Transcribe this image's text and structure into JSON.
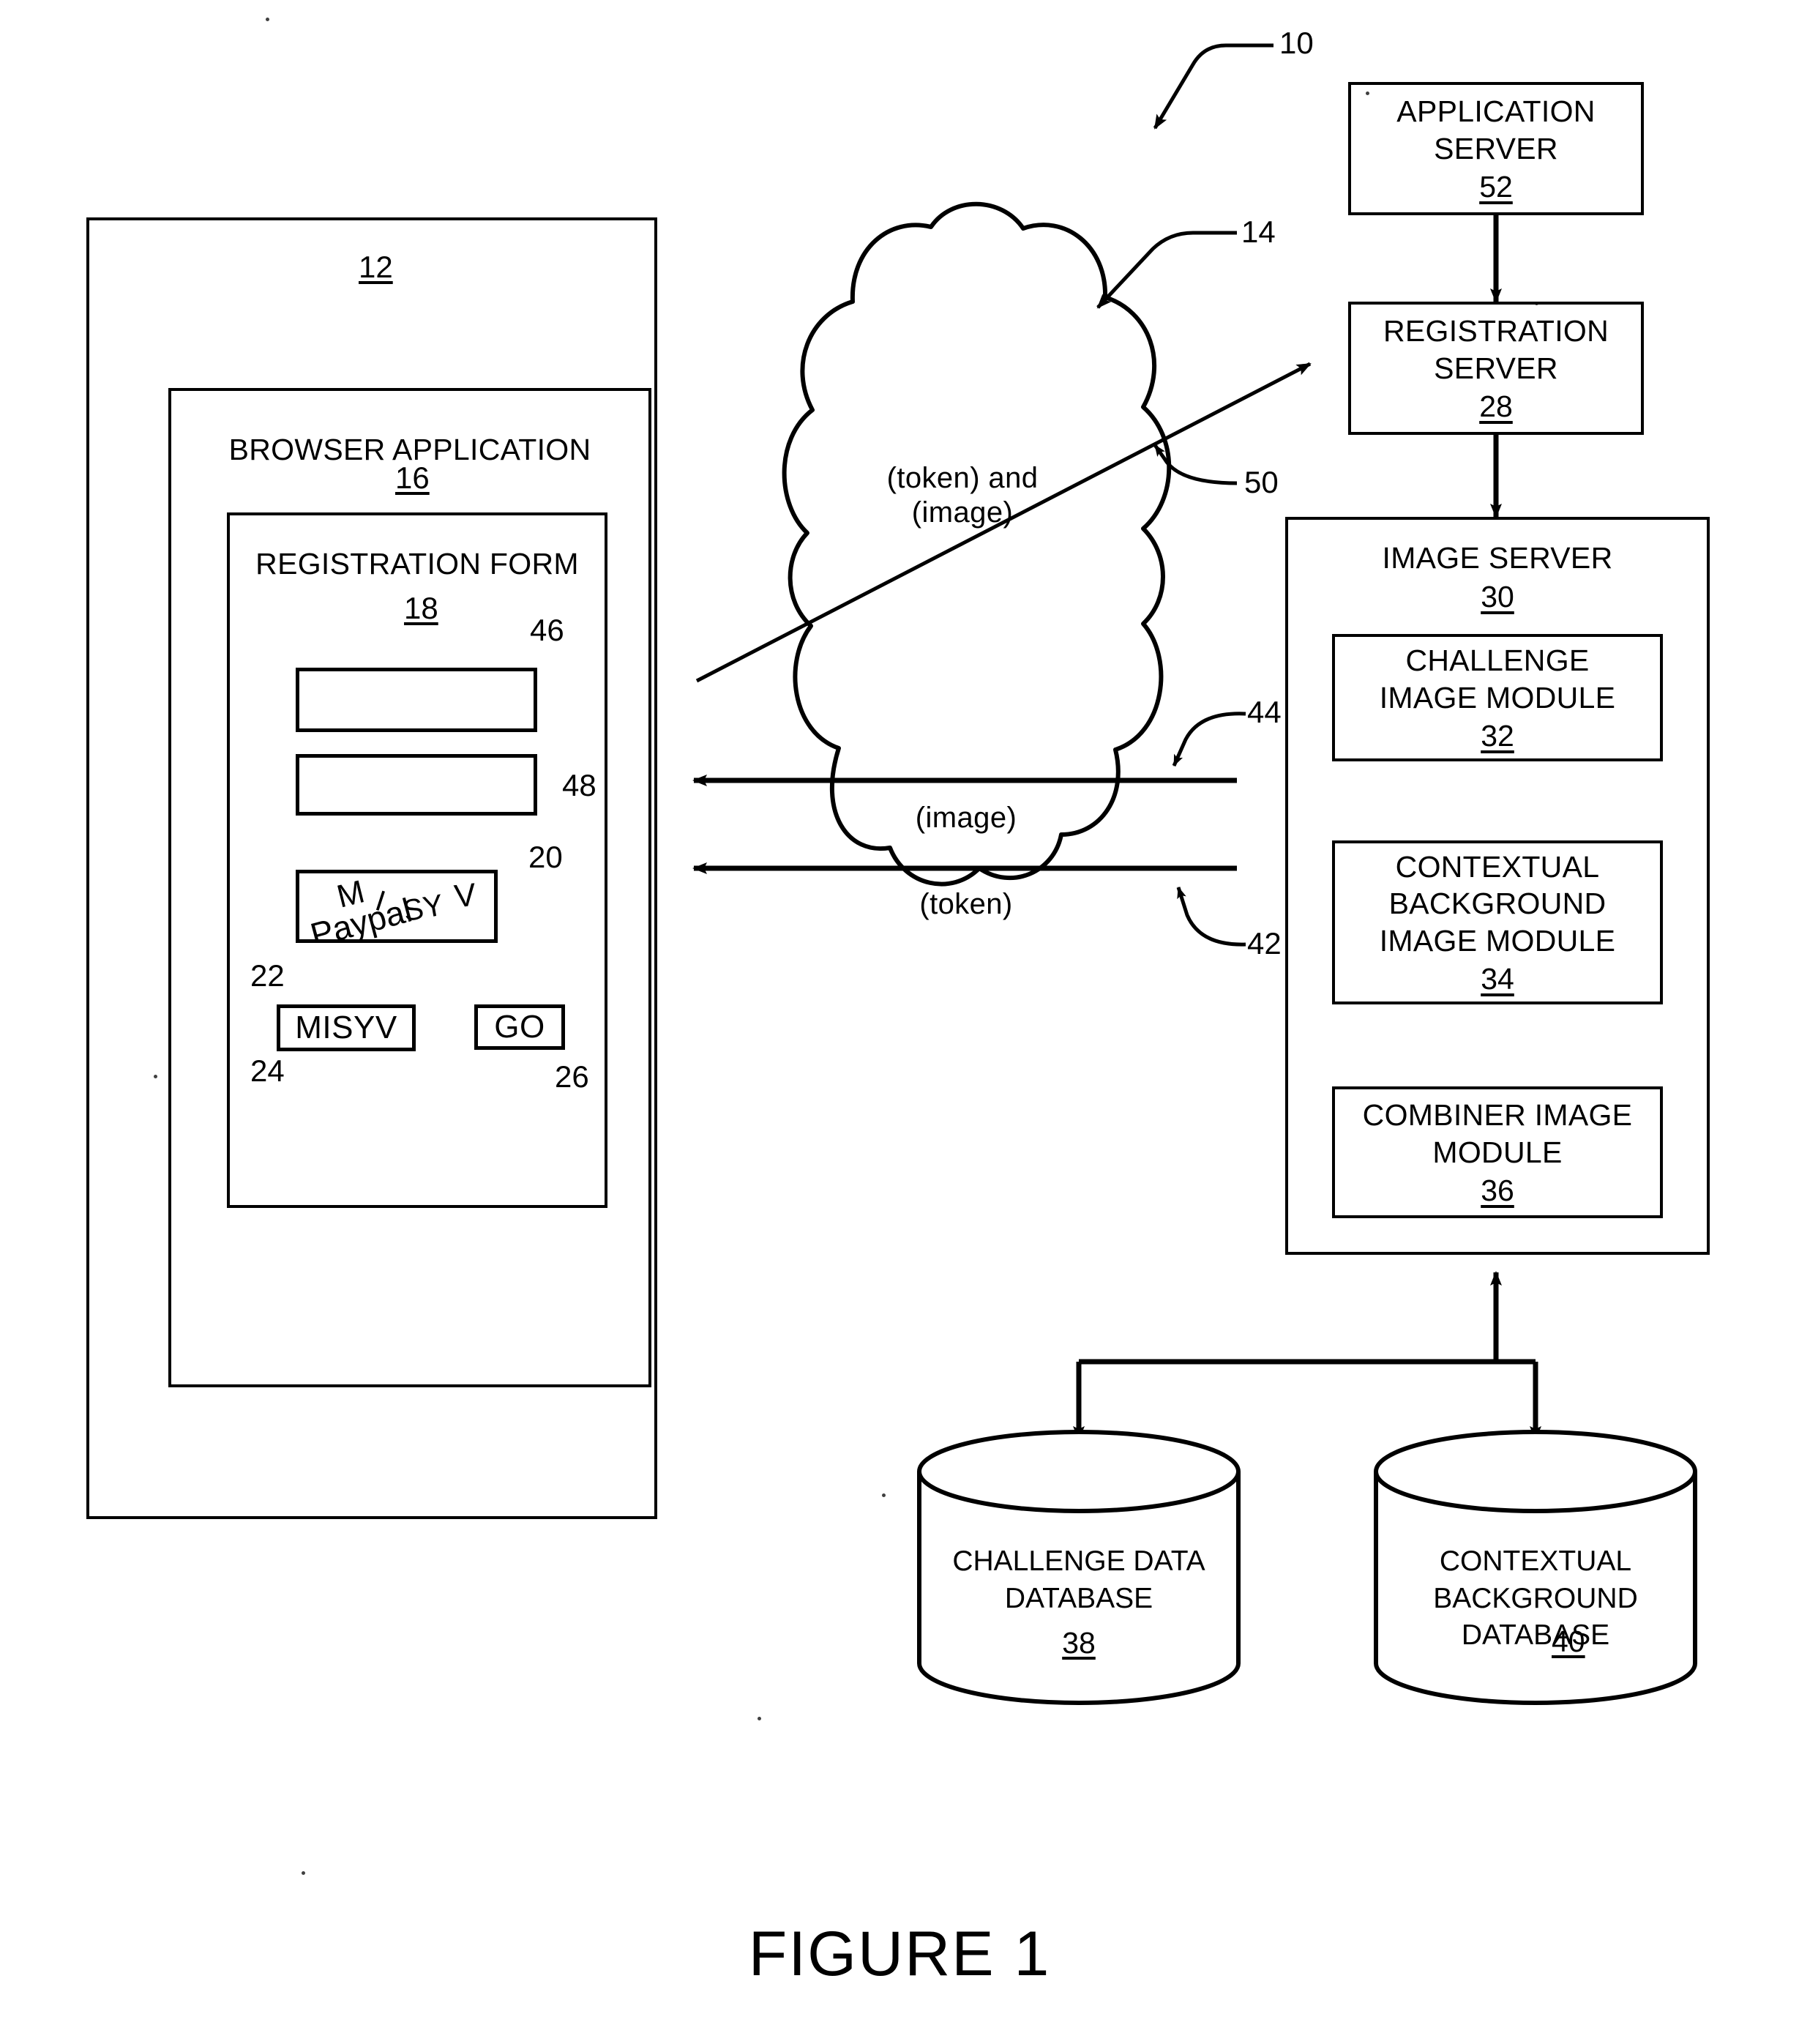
{
  "figure": {
    "caption": "FIGURE 1",
    "system_ref": "10"
  },
  "client": {
    "ref": "12",
    "browser": {
      "title": "BROWSER APPLICATION",
      "ref": "16"
    },
    "form": {
      "title": "REGISTRATION FORM",
      "ref": "18",
      "field_one_ref": "46",
      "field_two_ref": "48",
      "challenge_image": {
        "ref": "20",
        "background_ref": "22",
        "background_text": "Paypal",
        "challenge_chars": [
          "M",
          "I",
          "SY",
          "V"
        ]
      },
      "answer_input": {
        "value": "MISYV",
        "ref": "24"
      },
      "submit_button": {
        "label": "GO",
        "ref": "26"
      }
    }
  },
  "network": {
    "ref": "14",
    "label_top": "(token) and\n(image)",
    "label_image": "(image)",
    "label_token": "(token)",
    "arrow_up_ref": "50",
    "arrow_image_ref": "44",
    "arrow_token_ref": "42"
  },
  "servers": {
    "application_server": {
      "title": "APPLICATION\nSERVER",
      "ref": "52"
    },
    "registration_server": {
      "title": "REGISTRATION\nSERVER",
      "ref": "28"
    },
    "image_server": {
      "title": "IMAGE SERVER",
      "ref": "30",
      "modules": [
        {
          "title": "CHALLENGE\nIMAGE MODULE",
          "ref": "32"
        },
        {
          "title": "CONTEXTUAL\nBACKGROUND\nIMAGE MODULE",
          "ref": "34"
        },
        {
          "title": "COMBINER IMAGE\nMODULE",
          "ref": "36"
        }
      ]
    }
  },
  "databases": [
    {
      "title": "CHALLENGE DATA\nDATABASE",
      "ref": "38",
      "ref_inline": false
    },
    {
      "title": "CONTEXTUAL\nBACKGROUND\nDATABASE",
      "ref": "40",
      "ref_inline": true
    }
  ]
}
